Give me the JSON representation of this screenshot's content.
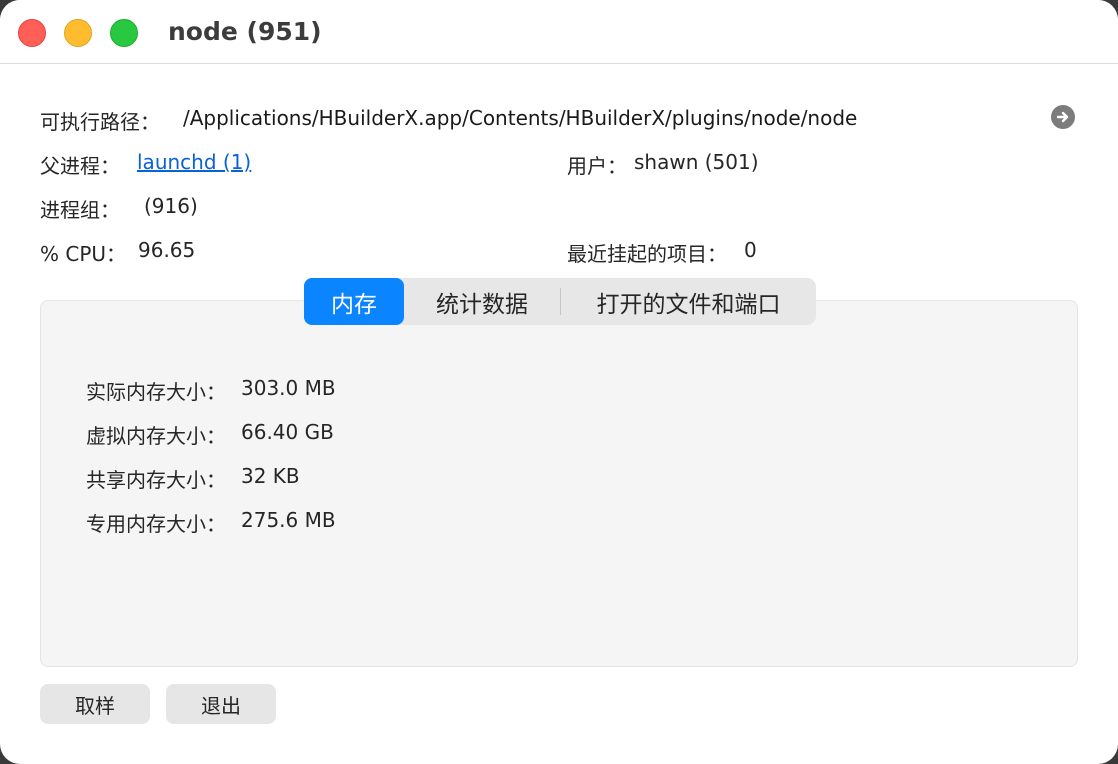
{
  "window": {
    "title": "node (951)"
  },
  "info": {
    "exec_path_label": "可执行路径：",
    "exec_path_value": "/Applications/HBuilderX.app/Contents/HBuilderX/plugins/node/node",
    "parent_label": "父进程：",
    "parent_value": "launchd (1)",
    "user_label": "用户：",
    "user_value": "shawn (501)",
    "group_label": "进程组：",
    "group_value": "(916)",
    "cpu_label": "% CPU：",
    "cpu_value": "96.65",
    "recent_hangs_label": "最近挂起的项目：",
    "recent_hangs_value": "0"
  },
  "tabs": [
    {
      "label": "内存",
      "active": true
    },
    {
      "label": "统计数据",
      "active": false
    },
    {
      "label": "打开的文件和端口",
      "active": false
    }
  ],
  "memory": [
    {
      "label": "实际内存大小：",
      "value": "303.0 MB"
    },
    {
      "label": "虚拟内存大小：",
      "value": "66.40 GB"
    },
    {
      "label": "共享内存大小：",
      "value": "32 KB"
    },
    {
      "label": "专用内存大小：",
      "value": "275.6 MB"
    }
  ],
  "buttons": {
    "sample": "取样",
    "quit": "退出"
  },
  "icons": {
    "reveal": "arrow-right-circle-icon"
  },
  "colors": {
    "accent": "#0b84ff",
    "link": "#0a63d6"
  }
}
